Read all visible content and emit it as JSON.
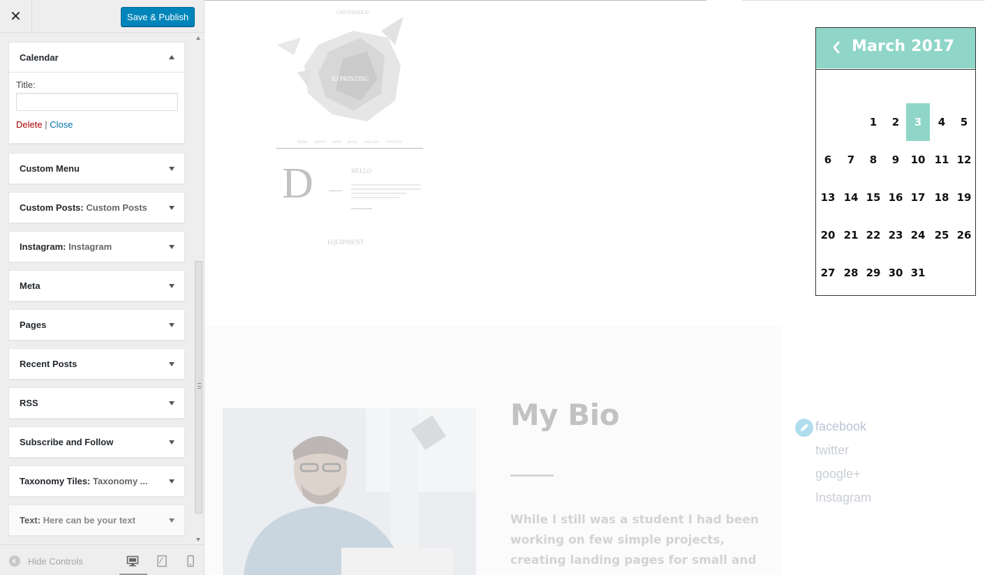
{
  "sidebar": {
    "save_label": "Save & Publish",
    "close_glyph": "✕",
    "calendar_widget": {
      "title": "Calendar",
      "field_label": "Title:",
      "field_value": "",
      "delete_label": "Delete",
      "separator": "|",
      "close_label": "Close"
    },
    "widgets": [
      {
        "title": "Custom Menu",
        "subtitle": ""
      },
      {
        "title": "Custom Posts:",
        "subtitle": "Custom Posts"
      },
      {
        "title": "Instagram:",
        "subtitle": "Instagram"
      },
      {
        "title": "Meta",
        "subtitle": ""
      },
      {
        "title": "Pages",
        "subtitle": ""
      },
      {
        "title": "Recent Posts",
        "subtitle": ""
      },
      {
        "title": "RSS",
        "subtitle": ""
      },
      {
        "title": "Subscribe and Follow",
        "subtitle": ""
      },
      {
        "title": "Taxonomy Tiles:",
        "subtitle": "Taxonomy ..."
      },
      {
        "title": "Text:",
        "subtitle": "Here can be your text"
      }
    ],
    "footer": {
      "hide_controls_label": "Hide Controls",
      "devices": [
        "desktop-icon",
        "tablet-icon",
        "mobile-icon"
      ]
    }
  },
  "preview": {
    "thumbnail": {
      "hero_label": "3D PRINTING",
      "top_label": "CREATEHOLD",
      "hello_label": "HELLO",
      "big_letter": "D",
      "section_label": "EQUIPMENT",
      "nav_items": [
        "HOME",
        "ABOUT",
        "SHOP",
        "BLOG",
        "GALLERY",
        "CONTACT"
      ]
    },
    "calendar": {
      "month": "March 2017",
      "today": 3,
      "first_weekday_index": 2,
      "days_in_month": 31,
      "accent": "#8fd6c8"
    },
    "bio": {
      "title": "My Bio",
      "text": "While I still was a student I had been working on few simple projects, creating landing pages for small and medium"
    },
    "social": [
      "facebook",
      "twitter",
      "google+",
      "Instagram"
    ]
  }
}
